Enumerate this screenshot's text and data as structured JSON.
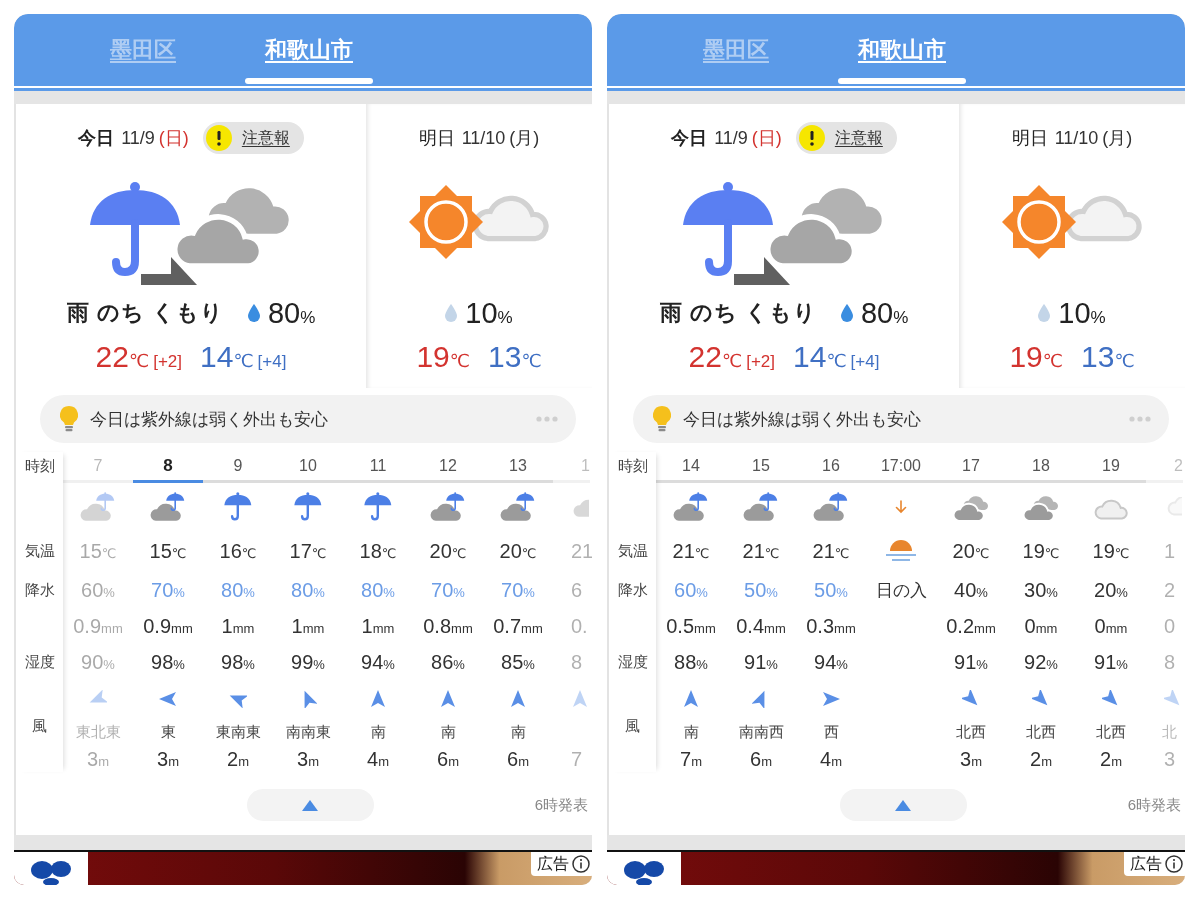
{
  "panels": [
    {
      "tabs": [
        {
          "label": "墨田区",
          "selected": false
        },
        {
          "label": "和歌山市",
          "selected": true
        }
      ],
      "days": [
        {
          "kind": "rain-then-cloudy",
          "day_label": "今日",
          "date": "11/9",
          "weekday": "(日)",
          "sunday": true,
          "alert": {
            "label": "注意報"
          },
          "summary": "雨 のち くもり",
          "precip": {
            "value": "80",
            "unit": "%",
            "likely": true
          },
          "high": {
            "value": "22",
            "unit": "℃",
            "diff": "[+2]"
          },
          "low": {
            "value": "14",
            "unit": "℃",
            "diff": "[+4]"
          }
        },
        {
          "kind": "sunny-then-cloudy",
          "day_label": "明日",
          "date": "11/10",
          "weekday": "(月)",
          "sunday": false,
          "precip": {
            "value": "10",
            "unit": "%",
            "likely": false
          },
          "high": {
            "value": "19",
            "unit": "℃"
          },
          "low": {
            "value": "13",
            "unit": "℃"
          }
        }
      ],
      "tip": {
        "text": "今日は紫外線は弱く外出も安心"
      },
      "hourly": {
        "labels": {
          "time": "時刻",
          "temperature": "気温",
          "precipitation": "降水",
          "humidity": "湿度",
          "wind": "風"
        },
        "columns": [
          {
            "kind": "cloud-umbrella",
            "time": "7",
            "current": false,
            "past": true,
            "temperature": {
              "value": "15",
              "unit": "℃"
            },
            "precipitation": {
              "value": "60",
              "unit": "%",
              "rainy": false
            },
            "amount": {
              "value": "0.9",
              "unit": "mm"
            },
            "humidity": {
              "value": "90",
              "unit": "%"
            },
            "wind": {
              "kind": "wsw",
              "direction": "東北東",
              "speed": {
                "value": "3",
                "unit": "m"
              }
            }
          },
          {
            "kind": "cloud-umbrella",
            "time": "8",
            "current": true,
            "past": false,
            "temperature": {
              "value": "15",
              "unit": "℃"
            },
            "precipitation": {
              "value": "70",
              "unit": "%",
              "rainy": true
            },
            "amount": {
              "value": "0.9",
              "unit": "mm"
            },
            "humidity": {
              "value": "98",
              "unit": "%"
            },
            "wind": {
              "kind": "w",
              "direction": "東",
              "speed": {
                "value": "3",
                "unit": "m"
              }
            }
          },
          {
            "kind": "umbrella",
            "time": "9",
            "current": false,
            "past": false,
            "temperature": {
              "value": "16",
              "unit": "℃"
            },
            "precipitation": {
              "value": "80",
              "unit": "%",
              "rainy": true
            },
            "amount": {
              "value": "1",
              "unit": "mm"
            },
            "humidity": {
              "value": "98",
              "unit": "%"
            },
            "wind": {
              "kind": "wnw",
              "direction": "東南東",
              "speed": {
                "value": "2",
                "unit": "m"
              }
            }
          },
          {
            "kind": "umbrella",
            "time": "10",
            "current": false,
            "past": false,
            "temperature": {
              "value": "17",
              "unit": "℃"
            },
            "precipitation": {
              "value": "80",
              "unit": "%",
              "rainy": true
            },
            "amount": {
              "value": "1",
              "unit": "mm"
            },
            "humidity": {
              "value": "99",
              "unit": "%"
            },
            "wind": {
              "kind": "nnw",
              "direction": "南南東",
              "speed": {
                "value": "3",
                "unit": "m"
              }
            }
          },
          {
            "kind": "umbrella",
            "time": "11",
            "current": false,
            "past": false,
            "temperature": {
              "value": "18",
              "unit": "℃"
            },
            "precipitation": {
              "value": "80",
              "unit": "%",
              "rainy": true
            },
            "amount": {
              "value": "1",
              "unit": "mm"
            },
            "humidity": {
              "value": "94",
              "unit": "%"
            },
            "wind": {
              "kind": "n",
              "direction": "南",
              "speed": {
                "value": "4",
                "unit": "m"
              }
            }
          },
          {
            "kind": "cloud-umbrella",
            "time": "12",
            "current": false,
            "past": false,
            "temperature": {
              "value": "20",
              "unit": "℃"
            },
            "precipitation": {
              "value": "70",
              "unit": "%",
              "rainy": true
            },
            "amount": {
              "value": "0.8",
              "unit": "mm"
            },
            "humidity": {
              "value": "86",
              "unit": "%"
            },
            "wind": {
              "kind": "n",
              "direction": "南",
              "speed": {
                "value": "6",
                "unit": "m"
              }
            }
          },
          {
            "kind": "cloud-umbrella",
            "time": "13",
            "current": false,
            "past": false,
            "temperature": {
              "value": "20",
              "unit": "℃"
            },
            "precipitation": {
              "value": "70",
              "unit": "%",
              "rainy": true
            },
            "amount": {
              "value": "0.7",
              "unit": "mm"
            },
            "humidity": {
              "value": "85",
              "unit": "%"
            },
            "wind": {
              "kind": "n",
              "direction": "南",
              "speed": {
                "value": "6",
                "unit": "m"
              }
            }
          }
        ],
        "cut_column": {
          "kind": "cloud-umbrella",
          "time": "1",
          "temperature": "21",
          "precipitation": "6",
          "amount": "0.",
          "humidity": "8",
          "wind": {
            "kind": "n",
            "speed": "7"
          }
        }
      },
      "footer": {
        "issued": "6時発表"
      },
      "ad": {
        "label": "広告"
      }
    },
    {
      "tabs": [
        {
          "label": "墨田区",
          "selected": false
        },
        {
          "label": "和歌山市",
          "selected": true
        }
      ],
      "days": [
        {
          "kind": "rain-then-cloudy",
          "day_label": "今日",
          "date": "11/9",
          "weekday": "(日)",
          "sunday": true,
          "alert": {
            "label": "注意報"
          },
          "summary": "雨 のち くもり",
          "precip": {
            "value": "80",
            "unit": "%",
            "likely": true
          },
          "high": {
            "value": "22",
            "unit": "℃",
            "diff": "[+2]"
          },
          "low": {
            "value": "14",
            "unit": "℃",
            "diff": "[+4]"
          }
        },
        {
          "kind": "sunny-then-cloudy",
          "day_label": "明日",
          "date": "11/10",
          "weekday": "(月)",
          "sunday": false,
          "precip": {
            "value": "10",
            "unit": "%",
            "likely": false
          },
          "high": {
            "value": "19",
            "unit": "℃"
          },
          "low": {
            "value": "13",
            "unit": "℃"
          }
        }
      ],
      "tip": {
        "text": "今日は紫外線は弱く外出も安心"
      },
      "hourly": {
        "labels": {
          "time": "時刻",
          "temperature": "気温",
          "precipitation": "降水",
          "humidity": "湿度",
          "wind": "風"
        },
        "columns": [
          {
            "kind": "cloud-umbrella",
            "time": "14",
            "current": false,
            "past": false,
            "temperature": {
              "value": "21",
              "unit": "℃"
            },
            "precipitation": {
              "value": "60",
              "unit": "%",
              "rainy": true
            },
            "amount": {
              "value": "0.5",
              "unit": "mm"
            },
            "humidity": {
              "value": "88",
              "unit": "%"
            },
            "wind": {
              "kind": "n",
              "direction": "南",
              "speed": {
                "value": "7",
                "unit": "m"
              }
            }
          },
          {
            "kind": "cloud-umbrella",
            "time": "15",
            "current": false,
            "past": false,
            "temperature": {
              "value": "21",
              "unit": "℃"
            },
            "precipitation": {
              "value": "50",
              "unit": "%",
              "rainy": true
            },
            "amount": {
              "value": "0.4",
              "unit": "mm"
            },
            "humidity": {
              "value": "91",
              "unit": "%"
            },
            "wind": {
              "kind": "nne",
              "direction": "南南西",
              "speed": {
                "value": "6",
                "unit": "m"
              }
            }
          },
          {
            "kind": "cloud-umbrella",
            "time": "16",
            "current": false,
            "past": false,
            "temperature": {
              "value": "21",
              "unit": "℃"
            },
            "precipitation": {
              "value": "50",
              "unit": "%",
              "rainy": true
            },
            "amount": {
              "value": "0.3",
              "unit": "mm"
            },
            "humidity": {
              "value": "94",
              "unit": "%"
            },
            "wind": {
              "kind": "e",
              "direction": "西",
              "speed": {
                "value": "4",
                "unit": "m"
              }
            }
          },
          {
            "kind": "sunset",
            "time": "17:00",
            "label": "日の入"
          },
          {
            "kind": "clouds",
            "time": "17",
            "current": false,
            "past": false,
            "temperature": {
              "value": "20",
              "unit": "℃"
            },
            "precipitation": {
              "value": "40",
              "unit": "%",
              "rainy": false
            },
            "amount": {
              "value": "0.2",
              "unit": "mm"
            },
            "humidity": {
              "value": "91",
              "unit": "%"
            },
            "wind": {
              "kind": "se",
              "direction": "北西",
              "speed": {
                "value": "3",
                "unit": "m"
              }
            }
          },
          {
            "kind": "clouds",
            "time": "18",
            "current": false,
            "past": false,
            "temperature": {
              "value": "19",
              "unit": "℃"
            },
            "precipitation": {
              "value": "30",
              "unit": "%",
              "rainy": false
            },
            "amount": {
              "value": "0",
              "unit": "mm"
            },
            "humidity": {
              "value": "92",
              "unit": "%"
            },
            "wind": {
              "kind": "se",
              "direction": "北西",
              "speed": {
                "value": "2",
                "unit": "m"
              }
            }
          },
          {
            "kind": "cloud",
            "time": "19",
            "current": false,
            "past": false,
            "temperature": {
              "value": "19",
              "unit": "℃"
            },
            "precipitation": {
              "value": "20",
              "unit": "%",
              "rainy": false
            },
            "amount": {
              "value": "0",
              "unit": "mm"
            },
            "humidity": {
              "value": "91",
              "unit": "%"
            },
            "wind": {
              "kind": "se",
              "direction": "北西",
              "speed": {
                "value": "2",
                "unit": "m"
              }
            }
          }
        ],
        "cut_column": {
          "kind": "cloud",
          "time": "2",
          "temperature": "1",
          "precipitation": "2",
          "amount": "0",
          "humidity": "8",
          "wind": {
            "kind": "se",
            "direction": "北",
            "speed": "3"
          }
        }
      },
      "footer": {
        "issued": "6時発表"
      },
      "ad": {
        "label": "広告"
      }
    }
  ]
}
